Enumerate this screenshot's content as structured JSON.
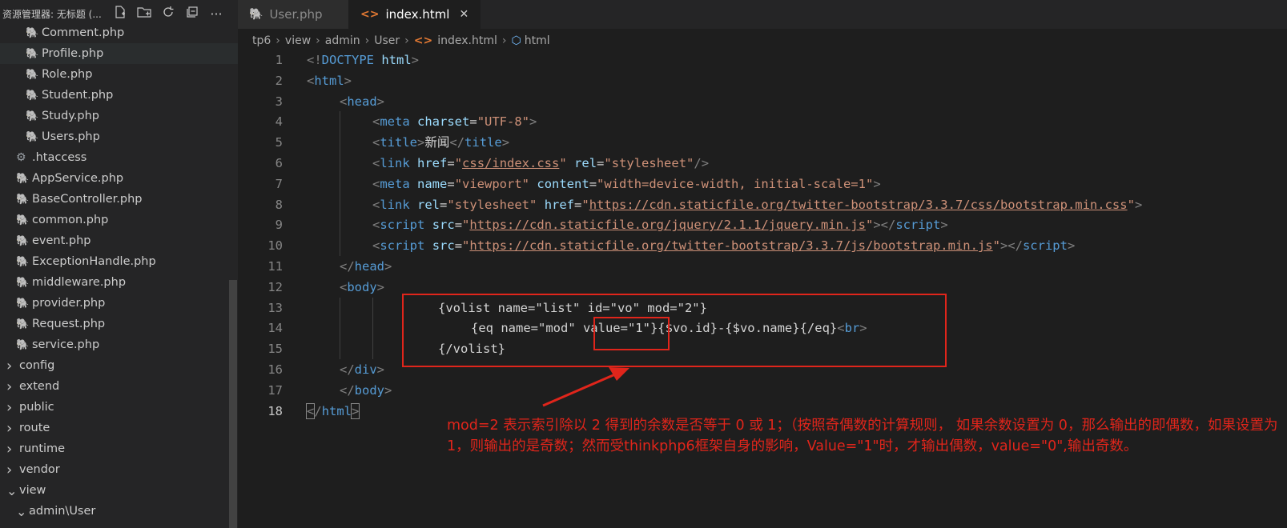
{
  "sidebar": {
    "title": "资源管理器: 无标题 (...",
    "header_icons": [
      "new-file-icon",
      "new-folder-icon",
      "refresh-icon",
      "collapse-icon",
      "more-icon"
    ],
    "items": [
      {
        "label": "Comment.php",
        "type": "php",
        "indent": 2
      },
      {
        "label": "Profile.php",
        "type": "php",
        "indent": 2,
        "active": true
      },
      {
        "label": "Role.php",
        "type": "php",
        "indent": 2
      },
      {
        "label": "Student.php",
        "type": "php",
        "indent": 2
      },
      {
        "label": "Study.php",
        "type": "php",
        "indent": 2
      },
      {
        "label": "Users.php",
        "type": "php",
        "indent": 2
      },
      {
        "label": ".htaccess",
        "type": "config",
        "indent": 1
      },
      {
        "label": "AppService.php",
        "type": "php",
        "indent": 1
      },
      {
        "label": "BaseController.php",
        "type": "php",
        "indent": 1
      },
      {
        "label": "common.php",
        "type": "php",
        "indent": 1
      },
      {
        "label": "event.php",
        "type": "php",
        "indent": 1
      },
      {
        "label": "ExceptionHandle.php",
        "type": "php",
        "indent": 1
      },
      {
        "label": "middleware.php",
        "type": "php",
        "indent": 1
      },
      {
        "label": "provider.php",
        "type": "php",
        "indent": 1
      },
      {
        "label": "Request.php",
        "type": "php",
        "indent": 1
      },
      {
        "label": "service.php",
        "type": "php",
        "indent": 1
      },
      {
        "label": "config",
        "type": "folder-closed",
        "indent": 0
      },
      {
        "label": "extend",
        "type": "folder-closed",
        "indent": 0
      },
      {
        "label": "public",
        "type": "folder-closed",
        "indent": 0
      },
      {
        "label": "route",
        "type": "folder-closed",
        "indent": 0
      },
      {
        "label": "runtime",
        "type": "folder-closed",
        "indent": 0
      },
      {
        "label": "vendor",
        "type": "folder-closed",
        "indent": 0
      },
      {
        "label": "view",
        "type": "folder-open",
        "indent": 0
      },
      {
        "label": "admin\\User",
        "type": "folder-open",
        "indent": 1
      }
    ]
  },
  "tabs": [
    {
      "label": "User.php",
      "type": "php",
      "active": false
    },
    {
      "label": "index.html",
      "type": "html",
      "active": true,
      "close": "✕"
    }
  ],
  "breadcrumb": [
    "tp6",
    "view",
    "admin",
    "User",
    "index.html",
    "html"
  ],
  "editor": {
    "current_line": 18,
    "lines": [
      {
        "n": "1",
        "indent": 0,
        "tokens": [
          [
            "b",
            "<!"
          ],
          [
            "tag",
            "DOCTYPE"
          ],
          [
            "text",
            " "
          ],
          [
            "attr",
            "html"
          ],
          [
            "b",
            ">"
          ]
        ]
      },
      {
        "n": "2",
        "indent": 0,
        "tokens": [
          [
            "b",
            "<"
          ],
          [
            "tag",
            "html"
          ],
          [
            "b",
            ">"
          ]
        ]
      },
      {
        "n": "3",
        "indent": 1,
        "tokens": [
          [
            "b",
            "<"
          ],
          [
            "tag",
            "head"
          ],
          [
            "b",
            ">"
          ]
        ]
      },
      {
        "n": "4",
        "indent": 2,
        "tokens": [
          [
            "b",
            "<"
          ],
          [
            "tag",
            "meta"
          ],
          [
            "text",
            " "
          ],
          [
            "attr",
            "charset"
          ],
          [
            "text",
            "="
          ],
          [
            "val",
            "\"UTF-8\""
          ],
          [
            "b",
            ">"
          ]
        ]
      },
      {
        "n": "5",
        "indent": 2,
        "tokens": [
          [
            "b",
            "<"
          ],
          [
            "tag",
            "title"
          ],
          [
            "b",
            ">"
          ],
          [
            "text",
            "新闻"
          ],
          [
            "b",
            "</"
          ],
          [
            "tag",
            "title"
          ],
          [
            "b",
            ">"
          ]
        ]
      },
      {
        "n": "6",
        "indent": 2,
        "tokens": [
          [
            "b",
            "<"
          ],
          [
            "tag",
            "link"
          ],
          [
            "text",
            " "
          ],
          [
            "attr",
            "href"
          ],
          [
            "text",
            "="
          ],
          [
            "val",
            "\""
          ],
          [
            "link",
            "css/index.css"
          ],
          [
            "val",
            "\""
          ],
          [
            "text",
            " "
          ],
          [
            "attr",
            "rel"
          ],
          [
            "text",
            "="
          ],
          [
            "val",
            "\"stylesheet\""
          ],
          [
            "b",
            "/>"
          ]
        ]
      },
      {
        "n": "7",
        "indent": 2,
        "tokens": [
          [
            "b",
            "<"
          ],
          [
            "tag",
            "meta"
          ],
          [
            "text",
            " "
          ],
          [
            "attr",
            "name"
          ],
          [
            "text",
            "="
          ],
          [
            "val",
            "\"viewport\""
          ],
          [
            "text",
            " "
          ],
          [
            "attr",
            "content"
          ],
          [
            "text",
            "="
          ],
          [
            "val",
            "\"width=device-width, initial-scale=1\""
          ],
          [
            "b",
            ">"
          ]
        ]
      },
      {
        "n": "8",
        "indent": 2,
        "tokens": [
          [
            "b",
            "<"
          ],
          [
            "tag",
            "link"
          ],
          [
            "text",
            " "
          ],
          [
            "attr",
            "rel"
          ],
          [
            "text",
            "="
          ],
          [
            "val",
            "\"stylesheet\""
          ],
          [
            "text",
            " "
          ],
          [
            "attr",
            "href"
          ],
          [
            "text",
            "="
          ],
          [
            "val",
            "\""
          ],
          [
            "link",
            "https://cdn.staticfile.org/twitter-bootstrap/3.3.7/css/bootstrap.min.css"
          ],
          [
            "val",
            "\""
          ],
          [
            "b",
            ">"
          ]
        ]
      },
      {
        "n": "9",
        "indent": 2,
        "tokens": [
          [
            "b",
            "<"
          ],
          [
            "tag",
            "script"
          ],
          [
            "text",
            " "
          ],
          [
            "attr",
            "src"
          ],
          [
            "text",
            "="
          ],
          [
            "val",
            "\""
          ],
          [
            "link",
            "https://cdn.staticfile.org/jquery/2.1.1/jquery.min.js"
          ],
          [
            "val",
            "\""
          ],
          [
            "b",
            "></"
          ],
          [
            "tag",
            "script"
          ],
          [
            "b",
            ">"
          ]
        ]
      },
      {
        "n": "10",
        "indent": 2,
        "tokens": [
          [
            "b",
            "<"
          ],
          [
            "tag",
            "script"
          ],
          [
            "text",
            " "
          ],
          [
            "attr",
            "src"
          ],
          [
            "text",
            "="
          ],
          [
            "val",
            "\""
          ],
          [
            "link",
            "https://cdn.staticfile.org/twitter-bootstrap/3.3.7/js/bootstrap.min.js"
          ],
          [
            "val",
            "\""
          ],
          [
            "b",
            "></"
          ],
          [
            "tag",
            "script"
          ],
          [
            "b",
            ">"
          ]
        ]
      },
      {
        "n": "11",
        "indent": 1,
        "tokens": [
          [
            "b",
            "</"
          ],
          [
            "tag",
            "head"
          ],
          [
            "b",
            ">"
          ]
        ]
      },
      {
        "n": "12",
        "indent": 1,
        "tokens": [
          [
            "b",
            "<"
          ],
          [
            "tag",
            "body"
          ],
          [
            "b",
            ">"
          ]
        ]
      },
      {
        "n": "13",
        "indent": 4,
        "tokens": [
          [
            "text",
            "{volist name=\"list\" id=\"vo\" mod=\"2\"}"
          ]
        ]
      },
      {
        "n": "14",
        "indent": 5,
        "tokens": [
          [
            "text",
            "{eq name=\"mod\" value=\"1\"}{$vo.id}-{$vo.name}{/eq}"
          ],
          [
            "b",
            "<"
          ],
          [
            "tag",
            "br"
          ],
          [
            "b",
            ">"
          ]
        ]
      },
      {
        "n": "15",
        "indent": 4,
        "tokens": [
          [
            "text",
            "{/volist}"
          ]
        ]
      },
      {
        "n": "16",
        "indent": 1,
        "tokens": [
          [
            "b",
            "</"
          ],
          [
            "tag",
            "div"
          ],
          [
            "b",
            ">"
          ]
        ]
      },
      {
        "n": "17",
        "indent": 1,
        "tokens": [
          [
            "b",
            "</"
          ],
          [
            "tag",
            "body"
          ],
          [
            "b",
            ">"
          ]
        ]
      },
      {
        "n": "18",
        "indent": 0,
        "tokens": [
          [
            "bcur",
            "<"
          ],
          [
            "b",
            "/"
          ],
          [
            "tag",
            "html"
          ],
          [
            "bcur",
            ">"
          ]
        ]
      }
    ]
  },
  "annotation": {
    "text": " mod=2 表示索引除以 2 得到的余数是否等于 0 或 1；（按照奇偶数的计算规则， 如果余数设置为 0，那么输出的即偶数，如果设置为 1，则输出的是奇数；然而受thinkphp6框架自身的影响，Value=\"1\"时，才输出偶数，value=\"0\",输出奇数。"
  },
  "colors": {
    "background": "#1e1e1e",
    "sidebar": "#252526",
    "tag": "#569cd6",
    "attr": "#9cdcfe",
    "string": "#ce9178",
    "annotation": "#e0251b"
  }
}
